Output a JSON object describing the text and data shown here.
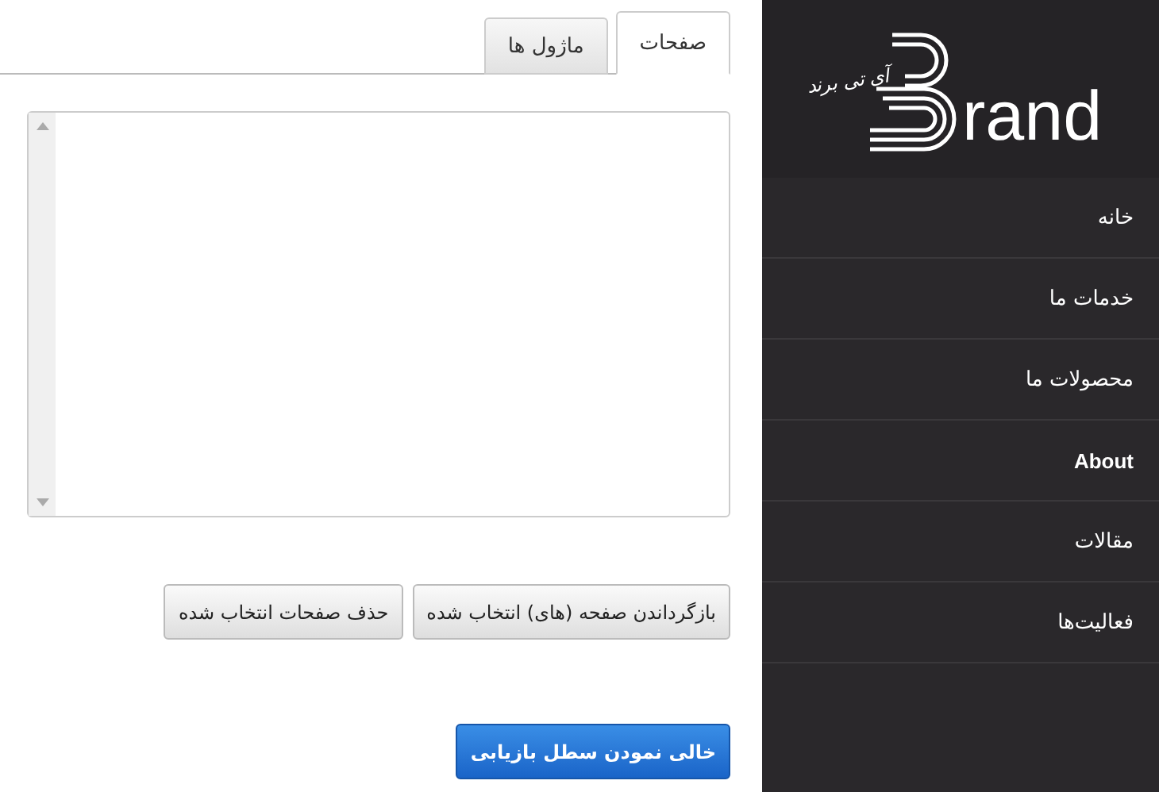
{
  "tabs": [
    {
      "label": "صفحات",
      "selected": true
    },
    {
      "label": "ماژول ها",
      "selected": false
    }
  ],
  "list_box": {
    "kind": "listbox"
  },
  "actions": [
    {
      "label": "بازگرداندن صفحه (های) انتخاب شده"
    },
    {
      "label": "حذف صفحات انتخاب شده"
    }
  ],
  "primary_action": {
    "label": "خالی نمودن سطل بازیابی"
  },
  "sidebar": {
    "logo": {
      "tagline": "آی تی برند",
      "wordmark": "rand"
    },
    "items": [
      {
        "label": "خانه"
      },
      {
        "label": "خدمات ما"
      },
      {
        "label": "محصولات ما"
      },
      {
        "label": "About"
      },
      {
        "label": "مقالات"
      },
      {
        "label": "فعالیت‌ها"
      }
    ]
  }
}
